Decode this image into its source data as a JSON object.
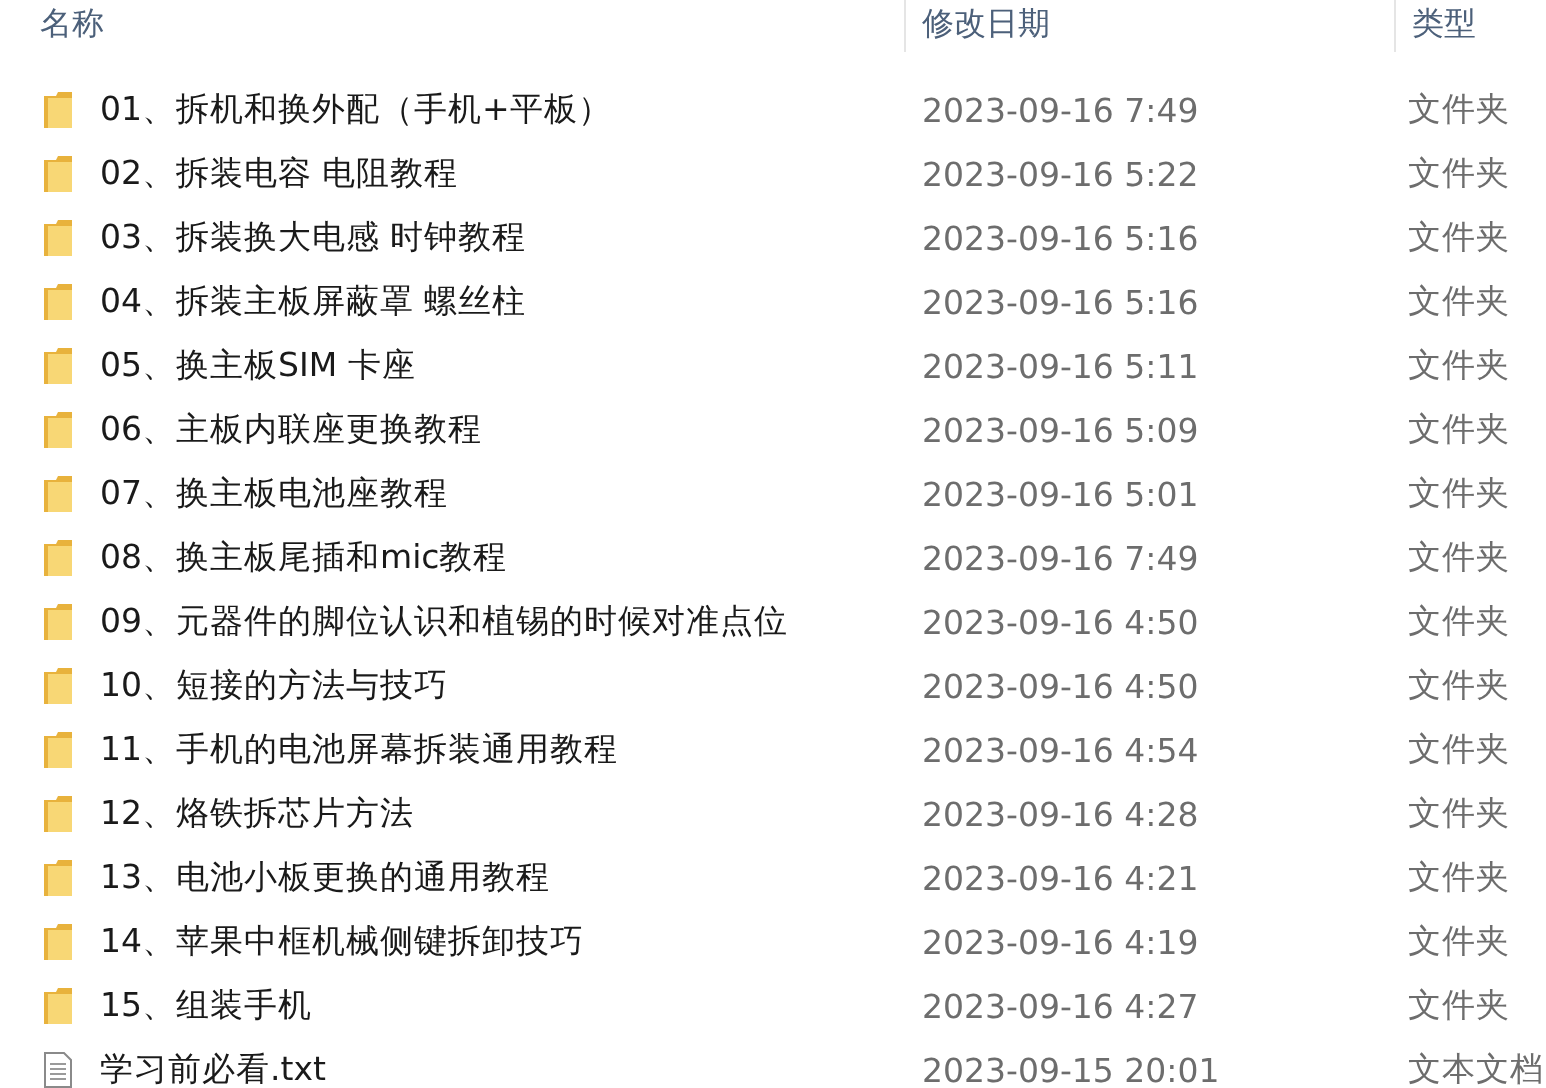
{
  "columns": [
    {
      "label": "名称"
    },
    {
      "label": "修改日期"
    },
    {
      "label": "类型"
    }
  ],
  "rows": [
    {
      "kind": "folder",
      "name": "01、拆机和换外配（手机+平板）",
      "date": "2023-09-16 7:49",
      "type": "文件夹"
    },
    {
      "kind": "folder",
      "name": "02、拆装电容 电阻教程",
      "date": "2023-09-16 5:22",
      "type": "文件夹"
    },
    {
      "kind": "folder",
      "name": "03、拆装换大电感 时钟教程",
      "date": "2023-09-16 5:16",
      "type": "文件夹"
    },
    {
      "kind": "folder",
      "name": "04、拆装主板屏蔽罩 螺丝柱",
      "date": "2023-09-16 5:16",
      "type": "文件夹"
    },
    {
      "kind": "folder",
      "name": "05、换主板SIM 卡座",
      "date": "2023-09-16 5:11",
      "type": "文件夹"
    },
    {
      "kind": "folder",
      "name": "06、主板内联座更换教程",
      "date": "2023-09-16 5:09",
      "type": "文件夹"
    },
    {
      "kind": "folder",
      "name": "07、换主板电池座教程",
      "date": "2023-09-16 5:01",
      "type": "文件夹"
    },
    {
      "kind": "folder",
      "name": "08、换主板尾插和mic教程",
      "date": "2023-09-16 7:49",
      "type": "文件夹"
    },
    {
      "kind": "folder",
      "name": "09、元器件的脚位认识和植锡的时候对准点位",
      "date": "2023-09-16 4:50",
      "type": "文件夹"
    },
    {
      "kind": "folder",
      "name": "10、短接的方法与技巧",
      "date": "2023-09-16 4:50",
      "type": "文件夹"
    },
    {
      "kind": "folder",
      "name": "11、手机的电池屏幕拆装通用教程",
      "date": "2023-09-16 4:54",
      "type": "文件夹"
    },
    {
      "kind": "folder",
      "name": "12、烙铁拆芯片方法",
      "date": "2023-09-16 4:28",
      "type": "文件夹"
    },
    {
      "kind": "folder",
      "name": "13、电池小板更换的通用教程",
      "date": "2023-09-16 4:21",
      "type": "文件夹"
    },
    {
      "kind": "folder",
      "name": "14、苹果中框机械侧键拆卸技巧",
      "date": "2023-09-16 4:19",
      "type": "文件夹"
    },
    {
      "kind": "folder",
      "name": "15、组装手机",
      "date": "2023-09-16 4:27",
      "type": "文件夹"
    },
    {
      "kind": "text",
      "name": "学习前必看.txt",
      "date": "2023-09-15 20:01",
      "type": "文本文档"
    }
  ]
}
